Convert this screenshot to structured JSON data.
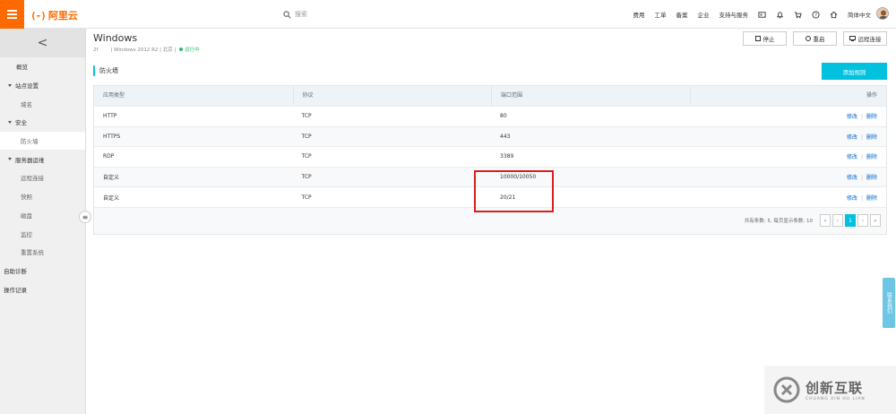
{
  "header": {
    "logo_mark": "(-)",
    "logo_text": "阿里云",
    "search_placeholder": "搜索",
    "links": [
      "费用",
      "工单",
      "备案",
      "企业",
      "支持与服务"
    ],
    "language": "简体中文"
  },
  "sidebar": {
    "back_label": "<",
    "items": [
      {
        "label": "概览",
        "type": "item"
      },
      {
        "label": "站点设置",
        "type": "group"
      },
      {
        "label": "域名",
        "type": "sub"
      },
      {
        "label": "安全",
        "type": "group"
      },
      {
        "label": "防火墙",
        "type": "sub",
        "active": true
      },
      {
        "label": "服务器运维",
        "type": "group"
      },
      {
        "label": "远程连接",
        "type": "sub"
      },
      {
        "label": "快照",
        "type": "sub"
      },
      {
        "label": "磁盘",
        "type": "sub"
      },
      {
        "label": "监控",
        "type": "sub"
      },
      {
        "label": "重置系统",
        "type": "sub"
      },
      {
        "label": "自助诊断",
        "type": "item"
      },
      {
        "label": "操作记录",
        "type": "item"
      }
    ]
  },
  "instance": {
    "title": "Windows",
    "subtitle_prefix": "2f",
    "subtitle_os": "| Windows 2012 R2 | 北京 |",
    "status": "运行中",
    "stop_label": "停止",
    "restart_label": "重启",
    "remote_label": "远程连接"
  },
  "firewall": {
    "section_title": "防火墙",
    "add_rule_label": "添加规则",
    "columns": [
      "应用类型",
      "协议",
      "端口范围",
      "操作"
    ],
    "rows": [
      {
        "app": "HTTP",
        "protocol": "TCP",
        "port": "80"
      },
      {
        "app": "HTTPS",
        "protocol": "TCP",
        "port": "443"
      },
      {
        "app": "RDP",
        "protocol": "TCP",
        "port": "3389"
      },
      {
        "app": "自定义",
        "protocol": "TCP",
        "port": "10000/10050"
      },
      {
        "app": "自定义",
        "protocol": "TCP",
        "port": "20/21"
      }
    ],
    "op_edit": "修改",
    "op_sep": "|",
    "op_delete": "删除",
    "pager_info": "共有条数: 5, 每页显示条数: 10",
    "pager_first": "«",
    "pager_prev": "‹",
    "pager_current": "1",
    "pager_next": "›",
    "pager_last": "»"
  },
  "contact_label": "联系我们",
  "watermark": {
    "cn": "创新互联",
    "en": "CHUANG XIN HU LIAN"
  },
  "colors": {
    "brand": "#ff6a00",
    "accent": "#00c1de",
    "link": "#0066cc",
    "highlight": "#d61f1f"
  }
}
